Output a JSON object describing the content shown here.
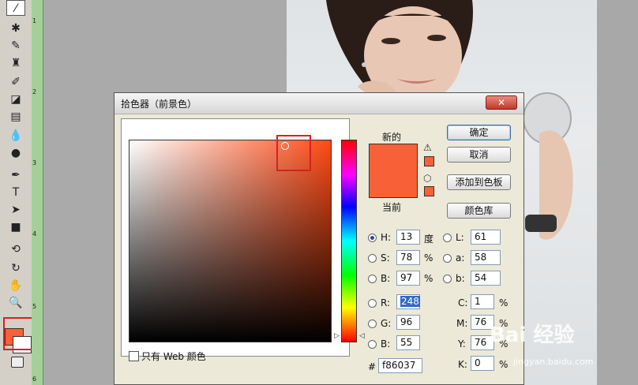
{
  "toolbar": {
    "tools": [
      "eyedropper",
      "healing",
      "brush",
      "stamp",
      "history-brush",
      "eraser",
      "gradient",
      "blur",
      "dodge",
      "pen",
      "type",
      "path-select",
      "shape",
      "3d-rotate",
      "3d-orbit",
      "hand",
      "zoom"
    ]
  },
  "ruler": {
    "marks": [
      "1",
      "2",
      "3",
      "4",
      "5",
      "6"
    ]
  },
  "dialog": {
    "title": "拾色器（前景色）",
    "close_label": "✕",
    "ok_label": "确定",
    "cancel_label": "取消",
    "add_swatch_label": "添加到色板",
    "libraries_label": "颜色库",
    "new_label": "新的",
    "current_label": "当前",
    "web_only_label": "只有 Web 颜色",
    "hsb": [
      {
        "label": "H:",
        "value": "13",
        "unit": "度",
        "selected": true
      },
      {
        "label": "S:",
        "value": "78",
        "unit": "%",
        "selected": false
      },
      {
        "label": "B:",
        "value": "97",
        "unit": "%",
        "selected": false
      }
    ],
    "lab": [
      {
        "label": "L:",
        "value": "61"
      },
      {
        "label": "a:",
        "value": "58"
      },
      {
        "label": "b:",
        "value": "54"
      }
    ],
    "rgb": [
      {
        "label": "R:",
        "value": "248"
      },
      {
        "label": "G:",
        "value": "96"
      },
      {
        "label": "B:",
        "value": "55"
      }
    ],
    "cmyk": [
      {
        "label": "C:",
        "value": "1",
        "unit": "%"
      },
      {
        "label": "M:",
        "value": "76",
        "unit": "%"
      },
      {
        "label": "Y:",
        "value": "76",
        "unit": "%"
      },
      {
        "label": "K:",
        "value": "0",
        "unit": "%"
      }
    ],
    "hex_label": "#",
    "hex_value": "f86037"
  },
  "colors": {
    "foreground": "#f86037",
    "accent": "#d42222"
  },
  "watermark": {
    "text": "Bai  经验",
    "sub": "jingyan.baidu.com"
  }
}
